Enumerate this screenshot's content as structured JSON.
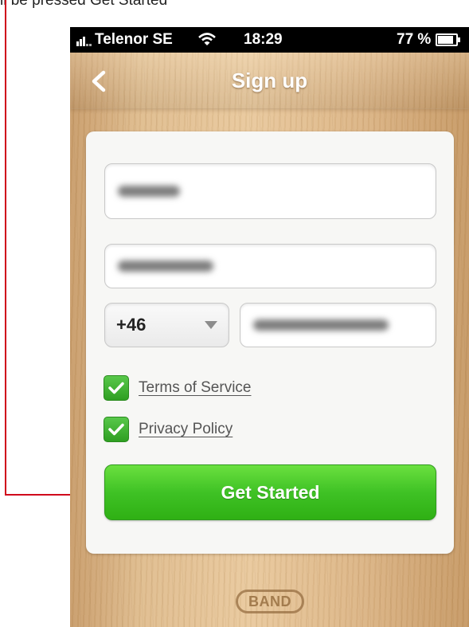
{
  "annotation": {
    "caption_fragment": "ll be pressed Get Started"
  },
  "status_bar": {
    "carrier": "Telenor SE",
    "time": "18:29",
    "battery": "77 %",
    "battery_level": 0.77
  },
  "navbar": {
    "title": "Sign up",
    "back_icon": "chevron-left-icon"
  },
  "form": {
    "name_value": "",
    "email_value": "",
    "country_code": "+46",
    "phone_value": "",
    "terms_label": "Terms of Service",
    "terms_checked": true,
    "privacy_label": "Privacy Policy",
    "privacy_checked": true,
    "submit_label": "Get Started"
  },
  "footer": {
    "logo_text": "BAND"
  },
  "colors": {
    "accent_green": "#3fc225",
    "annotation_red": "#d0021b"
  }
}
